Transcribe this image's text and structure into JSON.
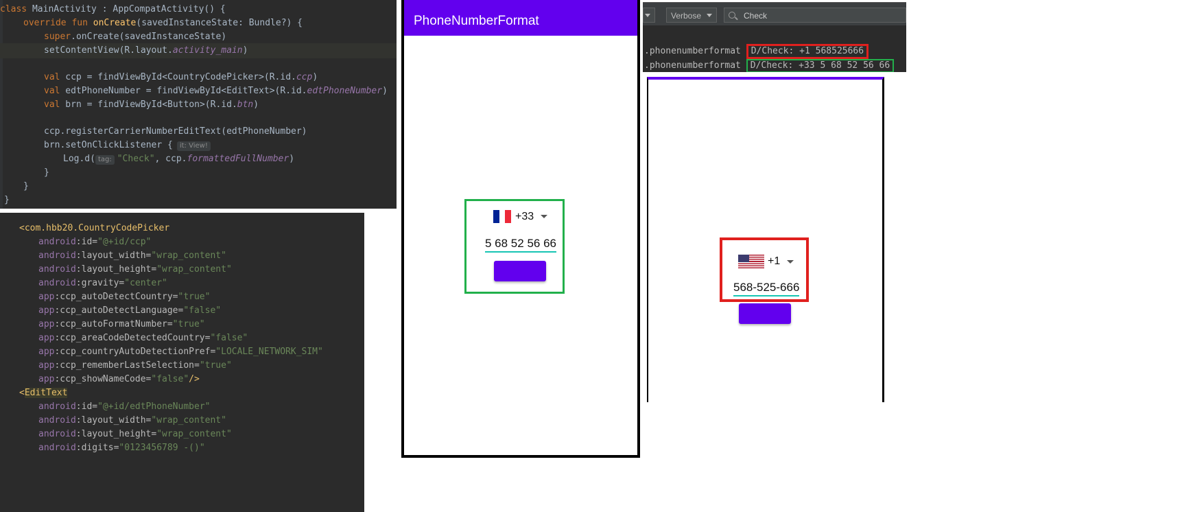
{
  "kotlin_code": {
    "class_line": {
      "kw": "class",
      "name": " MainActivity : AppCompatActivity() {"
    },
    "override_line": {
      "kw": "override fun ",
      "fn": "onCreate",
      "rest": "(savedInstanceState: Bundle?) {"
    },
    "super_line": {
      "kw": "super",
      "rest": ".onCreate(savedInstanceState)"
    },
    "setcontent_line": {
      "pre": "setContentView(R.layout.",
      "it": "activity_main",
      "post": ")"
    },
    "ccp_line": {
      "kw": "val",
      "pre": " ccp = findViewById<CountryCodePicker>(R.id.",
      "it": "ccp",
      "post": ")"
    },
    "edt_line": {
      "kw": "val",
      "pre": " edtPhoneNumber = findViewById<EditText>(R.id.",
      "it": "edtPhoneNumber",
      "post": ")"
    },
    "brn_line": {
      "kw": "val",
      "pre": " brn = findViewById<Button>(R.id.",
      "it": "btn",
      "post": ")"
    },
    "register_line": "ccp.registerCarrierNumberEditText(edtPhoneNumber)",
    "listener_line": {
      "text": "brn.setOnClickListener {",
      "hint": "it: View!"
    },
    "log_line": {
      "pre": "Log.d(",
      "hint": "tag:",
      "str": "\"Check\"",
      "mid": ", ccp.",
      "it": "formattedFullNumber",
      "post": ")"
    },
    "close1": "}",
    "close2": "}",
    "close3": "}"
  },
  "xml_code": {
    "ccp_open": "<com.hbb20.CountryCodePicker",
    "ccp_attrs": [
      {
        "ns": "android",
        "name": ":id=",
        "val": "\"@+id/ccp\""
      },
      {
        "ns": "android",
        "name": ":layout_width=",
        "val": "\"wrap_content\""
      },
      {
        "ns": "android",
        "name": ":layout_height=",
        "val": "\"wrap_content\""
      },
      {
        "ns": "android",
        "name": ":gravity=",
        "val": "\"center\""
      },
      {
        "ns": "app",
        "name": ":ccp_autoDetectCountry=",
        "val": "\"true\""
      },
      {
        "ns": "app",
        "name": ":ccp_autoDetectLanguage=",
        "val": "\"false\""
      },
      {
        "ns": "app",
        "name": ":ccp_autoFormatNumber=",
        "val": "\"true\""
      },
      {
        "ns": "app",
        "name": ":ccp_areaCodeDetectedCountry=",
        "val": "\"false\""
      },
      {
        "ns": "app",
        "name": ":ccp_countryAutoDetectionPref=",
        "val": "\"LOCALE_NETWORK_SIM\""
      },
      {
        "ns": "app",
        "name": ":ccp_rememberLastSelection=",
        "val": "\"true\""
      },
      {
        "ns": "app",
        "name": ":ccp_showNameCode=",
        "val": "\"false\""
      }
    ],
    "ccp_close": "/>",
    "edit_open_lt": "<",
    "edit_open_tag": "EditText",
    "edit_attrs": [
      {
        "ns": "android",
        "name": ":id=",
        "val": "\"@+id/edtPhoneNumber\""
      },
      {
        "ns": "android",
        "name": ":layout_width=",
        "val": "\"wrap_content\""
      },
      {
        "ns": "android",
        "name": ":layout_height=",
        "val": "\"wrap_content\""
      },
      {
        "ns": "android",
        "name": ":digits=",
        "val": "\"0123456789 -()\""
      }
    ]
  },
  "phone_left": {
    "app_title": "PhoneNumberFormat",
    "country_code": "+33",
    "phone_number": "5 68 52 56 66",
    "flag": "france-flag-icon"
  },
  "logcat": {
    "level": "Verbose",
    "search_value": "Check",
    "lines": [
      {
        "pkg": ".phonenumberformat",
        "msg": "D/Check: +1 568525666"
      },
      {
        "pkg": ".phonenumberformat",
        "msg": "D/Check: +33 5 68 52 56 66"
      }
    ]
  },
  "phone_right": {
    "country_code": "+1",
    "phone_number": "568-525-666",
    "flag": "usa-flag-icon"
  },
  "colors": {
    "primary": "#6200ee",
    "highlight_green": "#22b04b",
    "highlight_red": "#e0201e",
    "underline": "#16c5b3",
    "editor_bg": "#2b2b2b"
  }
}
